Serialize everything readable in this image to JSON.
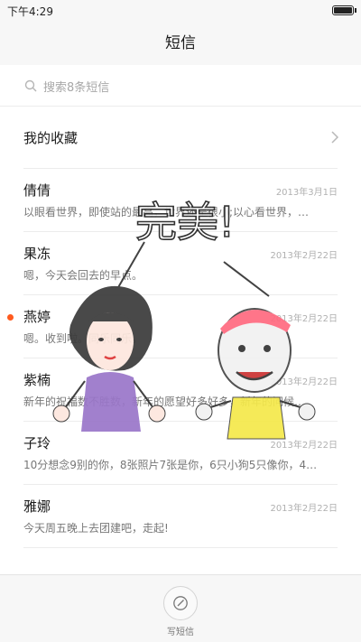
{
  "status_bar": {
    "time": "下午4:29"
  },
  "header": {
    "title": "短信"
  },
  "search": {
    "placeholder": "搜索8条短信"
  },
  "favorites": {
    "label": "我的收藏"
  },
  "messages": [
    {
      "sender": "倩倩",
      "date": "2013年3月1日",
      "preview": "以眼看世界，即使站的最高，世界还是很小;以心看世界，…",
      "unread": false
    },
    {
      "sender": "果冻",
      "date": "2013年2月22日",
      "preview": "嗯，今天会回去的早点。",
      "unread": false
    },
    {
      "sender": "燕婷",
      "date": "2013年2月22日",
      "preview": "嗯。收到啦。同乐同乐。",
      "unread": true
    },
    {
      "sender": "紫楠",
      "date": "2013年2月22日",
      "preview": "新年的祝福数不胜数，新年的愿望好多好多，新年的问候…",
      "unread": false
    },
    {
      "sender": "子玲",
      "date": "2013年2月22日",
      "preview": "10分想念9别的你，8张照片7张是你，6只小狗5只像你，4…",
      "unread": false
    },
    {
      "sender": "雅娜",
      "date": "2013年2月22日",
      "preview": "今天周五晚上去团建吧，走起!",
      "unread": false
    }
  ],
  "sticker": {
    "caption": "完美!"
  },
  "bottom": {
    "compose_label": "写短信"
  },
  "colors": {
    "unread_dot": "#ff5a1e",
    "bar_bg": "#f7f7f7"
  }
}
